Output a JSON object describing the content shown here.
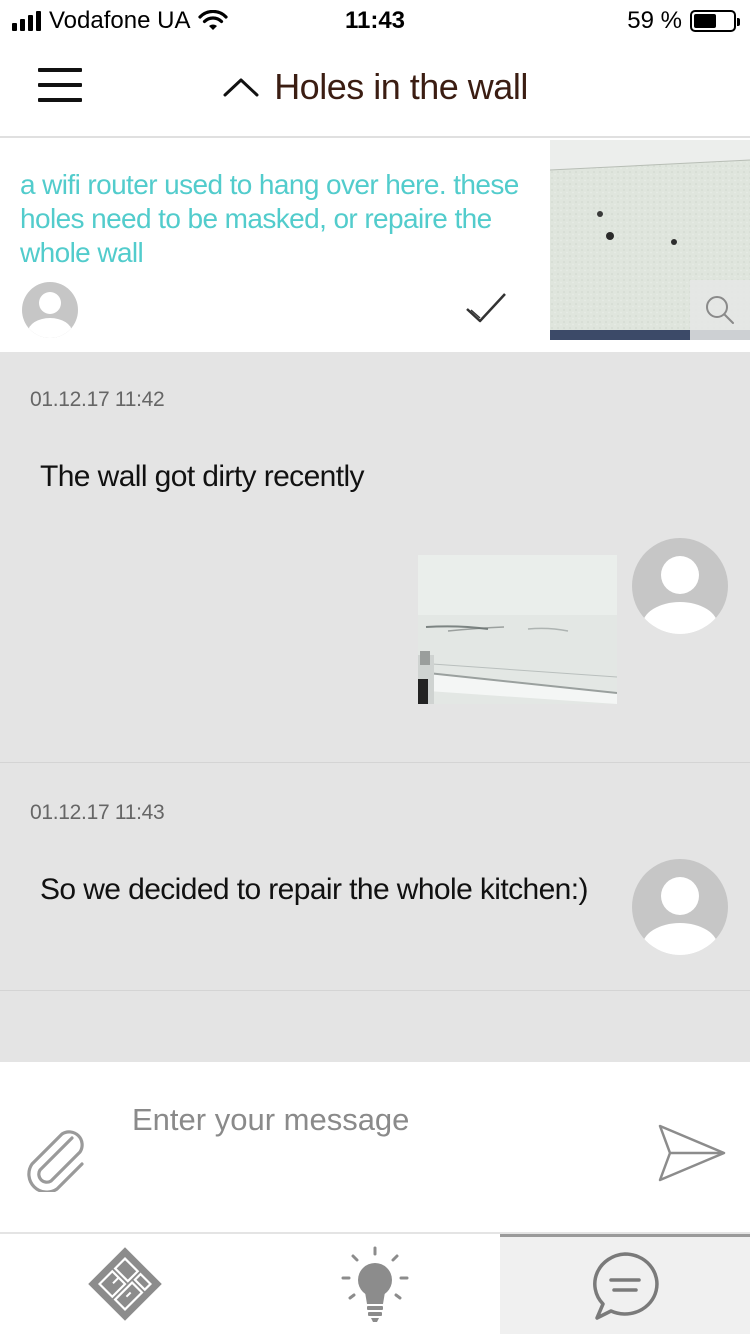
{
  "status_bar": {
    "carrier": "Vodafone UA",
    "time": "11:43",
    "battery_percent": "59 %",
    "battery_level": 0.59,
    "signal_bars": 4
  },
  "header": {
    "title": "Holes in the wall",
    "title_color": "#3b1d12"
  },
  "task": {
    "description": "a wifi router used to hang over here. these holes need to be masked, or repaire the whole wall",
    "text_color": "#52cccc"
  },
  "messages": [
    {
      "date": "01.12.17 11:42",
      "text": "The wall got dirty recently",
      "has_photo": true
    },
    {
      "date": "01.12.17 11:43",
      "text": "So we decided to repair the whole kitchen:)",
      "has_photo": false
    }
  ],
  "composer": {
    "placeholder": "Enter your message",
    "value": ""
  },
  "nav": {
    "tabs": [
      {
        "icon": "floor-plan-icon",
        "active": false
      },
      {
        "icon": "lightbulb-icon",
        "active": false
      },
      {
        "icon": "chat-bubble-icon",
        "active": true
      }
    ]
  },
  "colors": {
    "chat_background": "#e4e4e4",
    "accent_teal": "#52cccc",
    "icon_gray": "#8c8c8c"
  }
}
